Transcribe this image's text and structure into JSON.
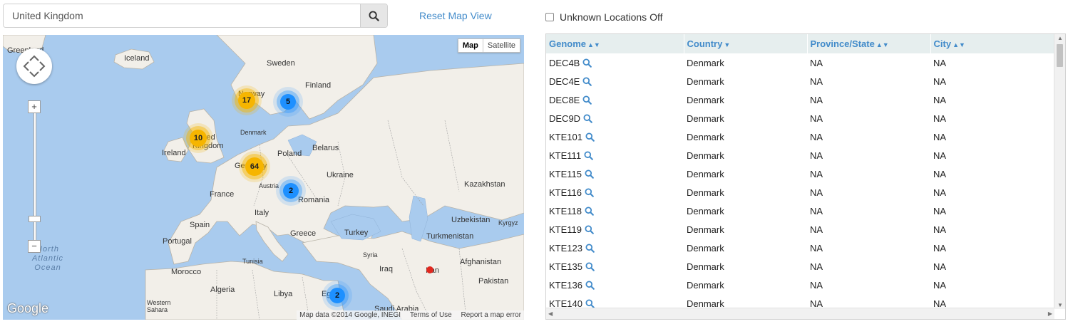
{
  "search": {
    "value": "United Kingdom",
    "button_icon": "search-icon"
  },
  "reset_label": "Reset Map View",
  "unknown_locations_label": "Unknown Locations Off",
  "map": {
    "type_buttons": [
      "Map",
      "Satellite"
    ],
    "labels": {
      "greenland": "Greenland",
      "iceland": "Iceland",
      "sweden": "Sweden",
      "norway": "Norway",
      "finland": "Finland",
      "denmark": "Denmark",
      "united_kingdom": "United Kingdom",
      "ireland": "Ireland",
      "belarus": "Belarus",
      "poland": "Poland",
      "germany": "Germany",
      "ukraine": "Ukraine",
      "kazakhstan": "Kazakhstan",
      "france": "France",
      "austria": "Austria",
      "romania": "Romania",
      "italy": "Italy",
      "spain": "Spain",
      "portugal": "Portugal",
      "uzbekistan": "Uzbekistan",
      "kyrgyz": "Kyrgyz",
      "turkmenistan": "Turkmenistan",
      "greece": "Greece",
      "turkey": "Turkey",
      "syria": "Syria",
      "iraq": "Iraq",
      "iran": "Iran",
      "afghanistan": "Afghanistan",
      "tunisia": "Tunisia",
      "morocco": "Morocco",
      "algeria": "Algeria",
      "libya": "Libya",
      "egypt": "Egypt",
      "pakistan": "Pakistan",
      "western_sahara": "Western Sahara",
      "saudi_arabia": "Saudi Arabia",
      "ocean": "North Atlantic Ocean"
    },
    "clusters": [
      {
        "id": "norway",
        "count": "17",
        "color": "yellow"
      },
      {
        "id": "sweden",
        "count": "5",
        "color": "blue"
      },
      {
        "id": "uk",
        "count": "10",
        "color": "yellow"
      },
      {
        "id": "germany",
        "count": "64",
        "color": "yellow"
      },
      {
        "id": "austria",
        "count": "2",
        "color": "blue"
      },
      {
        "id": "egypt",
        "count": "2",
        "color": "blue"
      }
    ],
    "google_logo": "Google",
    "attribution": {
      "data": "Map data ©2014 Google, INEGI",
      "terms": "Terms of Use",
      "report": "Report a map error"
    }
  },
  "table": {
    "headers": [
      "Genome",
      "Country",
      "Province/State",
      "City"
    ],
    "rows": [
      [
        "DEC4B",
        "Denmark",
        "NA",
        "NA"
      ],
      [
        "DEC4E",
        "Denmark",
        "NA",
        "NA"
      ],
      [
        "DEC8E",
        "Denmark",
        "NA",
        "NA"
      ],
      [
        "DEC9D",
        "Denmark",
        "NA",
        "NA"
      ],
      [
        "KTE101",
        "Denmark",
        "NA",
        "NA"
      ],
      [
        "KTE111",
        "Denmark",
        "NA",
        "NA"
      ],
      [
        "KTE115",
        "Denmark",
        "NA",
        "NA"
      ],
      [
        "KTE116",
        "Denmark",
        "NA",
        "NA"
      ],
      [
        "KTE118",
        "Denmark",
        "NA",
        "NA"
      ],
      [
        "KTE119",
        "Denmark",
        "NA",
        "NA"
      ],
      [
        "KTE123",
        "Denmark",
        "NA",
        "NA"
      ],
      [
        "KTE135",
        "Denmark",
        "NA",
        "NA"
      ],
      [
        "KTE136",
        "Denmark",
        "NA",
        "NA"
      ],
      [
        "KTE140",
        "Denmark",
        "NA",
        "NA"
      ]
    ]
  },
  "colors": {
    "link": "#428bca",
    "header_bg": "#e6eeee",
    "cluster_yellow": "#f6b500",
    "cluster_blue": "#1e90ff",
    "marker_red": "#e0281f",
    "water": "#a9cbee",
    "land": "#f2efe9"
  }
}
